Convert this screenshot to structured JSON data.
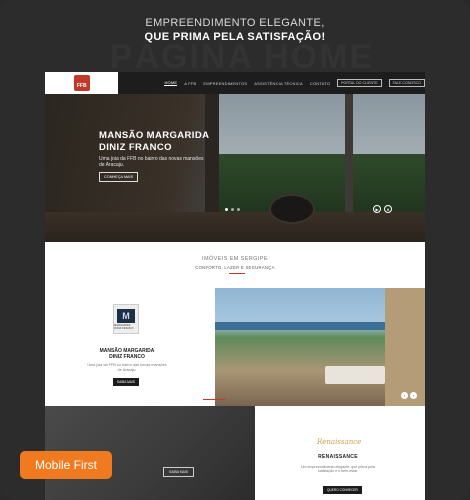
{
  "header": {
    "line1": "EMPREENDIMENTO ELEGANTE,",
    "line2": "QUE PRIMA PELA SATISFAÇÃO!",
    "watermark": "PÁGINA HOME"
  },
  "site": {
    "logo": "FFB",
    "nav": {
      "links": [
        "HOME",
        "A FFB",
        "EMPREENDIMENTOS",
        "ASSISTÊNCIA TÉCNICA",
        "CONTATO"
      ],
      "buttons": [
        "PORTAL DO CLIENTE",
        "FALE CONOSCO"
      ]
    },
    "hero": {
      "title_line1": "MANSÃO MARGARIDA",
      "title_line2": "DINIZ FRANCO",
      "subtitle": "Uma joia da FFB no bairro das novas mansões de Aracaju.",
      "cta": "CONHEÇA MAIS"
    },
    "section": {
      "title": "IMÓVEIS EM SERGIPE",
      "subtitle": "CONFORTO, LAZER E SEGURANÇA"
    },
    "project": {
      "logo_mark": "M",
      "logo_text": "MARGARIDA DINIZ FRANCO",
      "name_line1": "MANSÃO MARGARIDA",
      "name_line2": "DINIZ FRANCO",
      "desc": "Uma joia da FFB no bairro das novas mansões de Aracaju.",
      "cta": "SAIBA MAIS"
    },
    "bottom": {
      "dark_btn": "SAIBA MAIS",
      "ren_logo": "Renaissance",
      "ren_name": "RENAISSANCE",
      "ren_desc": "Um empreendimento elegante, que prima pela satisfação e o bem-estar.",
      "ren_cta": "QUERO CONHECER"
    }
  },
  "badge": "Mobile First",
  "colors": {
    "accent": "#c0392b",
    "badge": "#f07a1f",
    "page_bg": "#2c2c2c"
  }
}
